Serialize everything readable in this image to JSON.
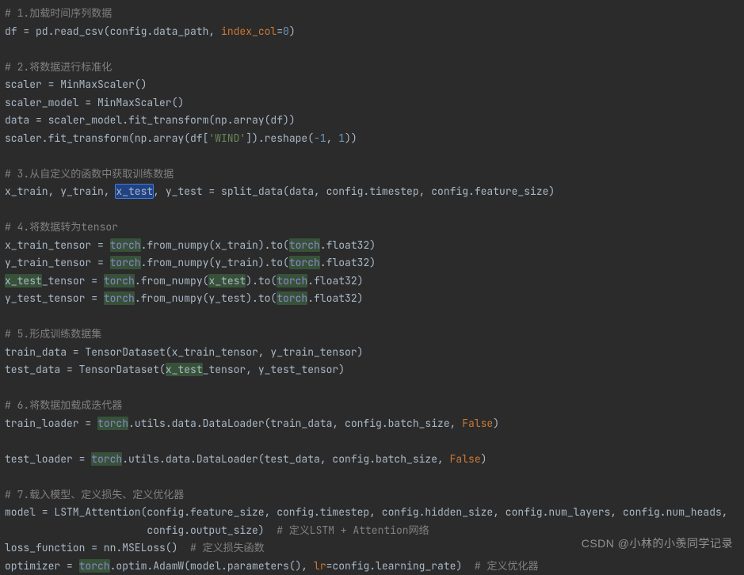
{
  "watermark": "CSDN @小林的小羡同学记录",
  "code": {
    "line01": "# 1.加载时间序列数据",
    "line02a": "df = pd.read_csv(config.data_path, ",
    "line02_kw": "index_col",
    "line02b": "=",
    "line02_num": "0",
    "line02c": ")",
    "line04": "# 2.将数据进行标准化",
    "line05": "scaler = MinMaxScaler()",
    "line06": "scaler_model = MinMaxScaler()",
    "line07": "data = scaler_model.fit_transform(np.array(df))",
    "line08a": "scaler.fit_transform(np.array(df[",
    "line08_str": "'WIND'",
    "line08b": "]).reshape(",
    "line08_n1": "-1",
    "line08c": ", ",
    "line08_n2": "1",
    "line08d": "))",
    "line10": "# 3.从自定义的函数中获取训练数据",
    "line11a": "x_train, y_train, ",
    "line11_hl": "x_test",
    "line11b": ", y_test = split_data(data, config.timestep, config.feature_size)",
    "line13": "# 4.将数据转为tensor",
    "line14a": "x_train_tensor = ",
    "line14_t1": "torch",
    "line14b": ".from_numpy(x_train).to(",
    "line14_t2": "torch",
    "line14c": ".float32)",
    "line15a": "y_train_tensor = ",
    "line15_t1": "torch",
    "line15b": ".from_numpy(y_train).to(",
    "line15_t2": "torch",
    "line15c": ".float32)",
    "line16_hl1": "x_test",
    "line16a": "_tensor = ",
    "line16_t1": "torch",
    "line16b": ".from_numpy(",
    "line16_hl2": "x_test",
    "line16c": ").to(",
    "line16_t2": "torch",
    "line16d": ".float32)",
    "line17a": "y_test_tensor = ",
    "line17_t1": "torch",
    "line17b": ".from_numpy(y_test).to(",
    "line17_t2": "torch",
    "line17c": ".float32)",
    "line19": "# 5.形成训练数据集",
    "line20": "train_data = TensorDataset(x_train_tensor, y_train_tensor)",
    "line21a": "test_data = TensorDataset(",
    "line21_hl": "x_test",
    "line21b": "_tensor, y_test_tensor)",
    "line23": "# 6.将数据加载成迭代器",
    "line24a": "train_loader = ",
    "line24_t": "torch",
    "line24b": ".utils.data.DataLoader(train_data, config.batch_size, ",
    "line24_f": "False",
    "line24c": ")",
    "line26a": "test_loader = ",
    "line26_t": "torch",
    "line26b": ".utils.data.DataLoader(test_data, config.batch_size, ",
    "line26_f": "False",
    "line26c": ")",
    "line28": "# 7.载入模型、定义损失、定义优化器",
    "line29": "model = LSTM_Attention(config.feature_size, config.timestep, config.hidden_size, config.num_layers, config.num_heads,",
    "line30a": "                       config.output_size)  ",
    "line30_cm": "# 定义LSTM + Attention网络",
    "line31a": "loss_function = nn.MSELoss()  ",
    "line31_cm": "# 定义损失函数",
    "line32a": "optimizer = ",
    "line32_t": "torch",
    "line32b": ".optim.AdamW(model.parameters(), ",
    "line32_kw": "lr",
    "line32c": "=config.learning_rate)  ",
    "line32_cm": "# 定义优化器"
  }
}
